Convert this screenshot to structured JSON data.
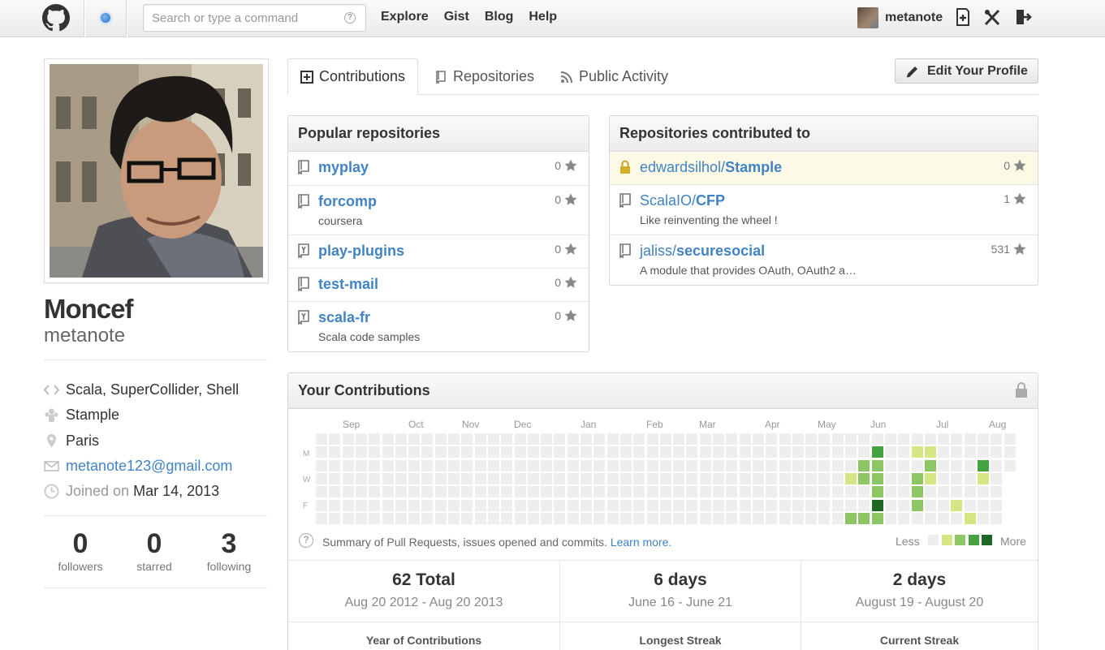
{
  "header": {
    "search_placeholder": "Search or type a command",
    "nav": [
      "Explore",
      "Gist",
      "Blog",
      "Help"
    ],
    "username": "metanote"
  },
  "profile": {
    "fullname": "Moncef",
    "username": "metanote",
    "languages": "Scala, SuperCollider, Shell",
    "organization": "Stample",
    "location": "Paris",
    "email": "metanote123@gmail.com",
    "joined_label": "Joined on",
    "joined_date": "Mar 14, 2013",
    "stats": [
      {
        "value": "0",
        "label": "followers"
      },
      {
        "value": "0",
        "label": "starred"
      },
      {
        "value": "3",
        "label": "following"
      }
    ]
  },
  "tabs": {
    "contributions": "Contributions",
    "repositories": "Repositories",
    "activity": "Public Activity",
    "edit_profile": "Edit Your Profile"
  },
  "popular": {
    "title": "Popular repositories",
    "repos": [
      {
        "name": "myplay",
        "desc": "",
        "stars": "0",
        "fork": false
      },
      {
        "name": "forcomp",
        "desc": "coursera",
        "stars": "0",
        "fork": false
      },
      {
        "name": "play-plugins",
        "desc": "",
        "stars": "0",
        "fork": true
      },
      {
        "name": "test-mail",
        "desc": "",
        "stars": "0",
        "fork": false
      },
      {
        "name": "scala-fr",
        "desc": "Scala code samples",
        "stars": "0",
        "fork": true
      }
    ]
  },
  "contributed": {
    "title": "Repositories contributed to",
    "repos": [
      {
        "owner": "edwardsilhol/",
        "name": "Stample",
        "desc": "",
        "stars": "0",
        "private": true
      },
      {
        "owner": "ScalaIO/",
        "name": "CFP",
        "desc": "Like reinventing the wheel !",
        "stars": "1",
        "private": false
      },
      {
        "owner": "jaliss/",
        "name": "securesocial",
        "desc": "A module that provides OAuth, OAuth2 a…",
        "stars": "531",
        "private": false
      }
    ]
  },
  "contributions": {
    "title": "Your Contributions",
    "months": [
      "Sep",
      "Oct",
      "Nov",
      "Dec",
      "Jan",
      "Feb",
      "Mar",
      "Apr",
      "May",
      "Jun",
      "Jul",
      "Aug"
    ],
    "day_labels": [
      "M",
      "W",
      "F"
    ],
    "summary_text": "Summary of Pull Requests, issues opened and commits.",
    "learn_more": "Learn more.",
    "legend_less": "Less",
    "legend_more": "More",
    "colors": [
      "#eeeeee",
      "#d6e685",
      "#8cc665",
      "#44a340",
      "#1e6823"
    ],
    "active_cells": [
      {
        "week": 42,
        "day": 1,
        "level": 3
      },
      {
        "week": 42,
        "day": 2,
        "level": 2
      },
      {
        "week": 42,
        "day": 3,
        "level": 2
      },
      {
        "week": 42,
        "day": 4,
        "level": 2
      },
      {
        "week": 42,
        "day": 5,
        "level": 4
      },
      {
        "week": 42,
        "day": 6,
        "level": 2
      },
      {
        "week": 41,
        "day": 2,
        "level": 2
      },
      {
        "week": 41,
        "day": 3,
        "level": 2
      },
      {
        "week": 41,
        "day": 6,
        "level": 2
      },
      {
        "week": 40,
        "day": 3,
        "level": 1
      },
      {
        "week": 40,
        "day": 6,
        "level": 2
      },
      {
        "week": 45,
        "day": 1,
        "level": 1
      },
      {
        "week": 45,
        "day": 3,
        "level": 2
      },
      {
        "week": 45,
        "day": 4,
        "level": 2
      },
      {
        "week": 45,
        "day": 5,
        "level": 2
      },
      {
        "week": 45,
        "day": 7,
        "level": 1
      },
      {
        "week": 46,
        "day": 1,
        "level": 1
      },
      {
        "week": 46,
        "day": 2,
        "level": 2
      },
      {
        "week": 46,
        "day": 3,
        "level": 1
      },
      {
        "week": 44,
        "day": 7,
        "level": 3
      },
      {
        "week": 48,
        "day": 5,
        "level": 1
      },
      {
        "week": 49,
        "day": 6,
        "level": 1
      },
      {
        "week": 50,
        "day": 2,
        "level": 3
      },
      {
        "week": 50,
        "day": 3,
        "level": 1
      },
      {
        "week": 50,
        "day": 7,
        "level": 1
      }
    ],
    "summaries": [
      {
        "big": "62 Total",
        "range": "Aug 20 2012 - Aug 20 2013",
        "caption": "Year of Contributions"
      },
      {
        "big": "6 days",
        "range": "June 16 - June 21",
        "caption": "Longest Streak"
      },
      {
        "big": "2 days",
        "range": "August 19 - August 20",
        "caption": "Current Streak"
      }
    ]
  }
}
